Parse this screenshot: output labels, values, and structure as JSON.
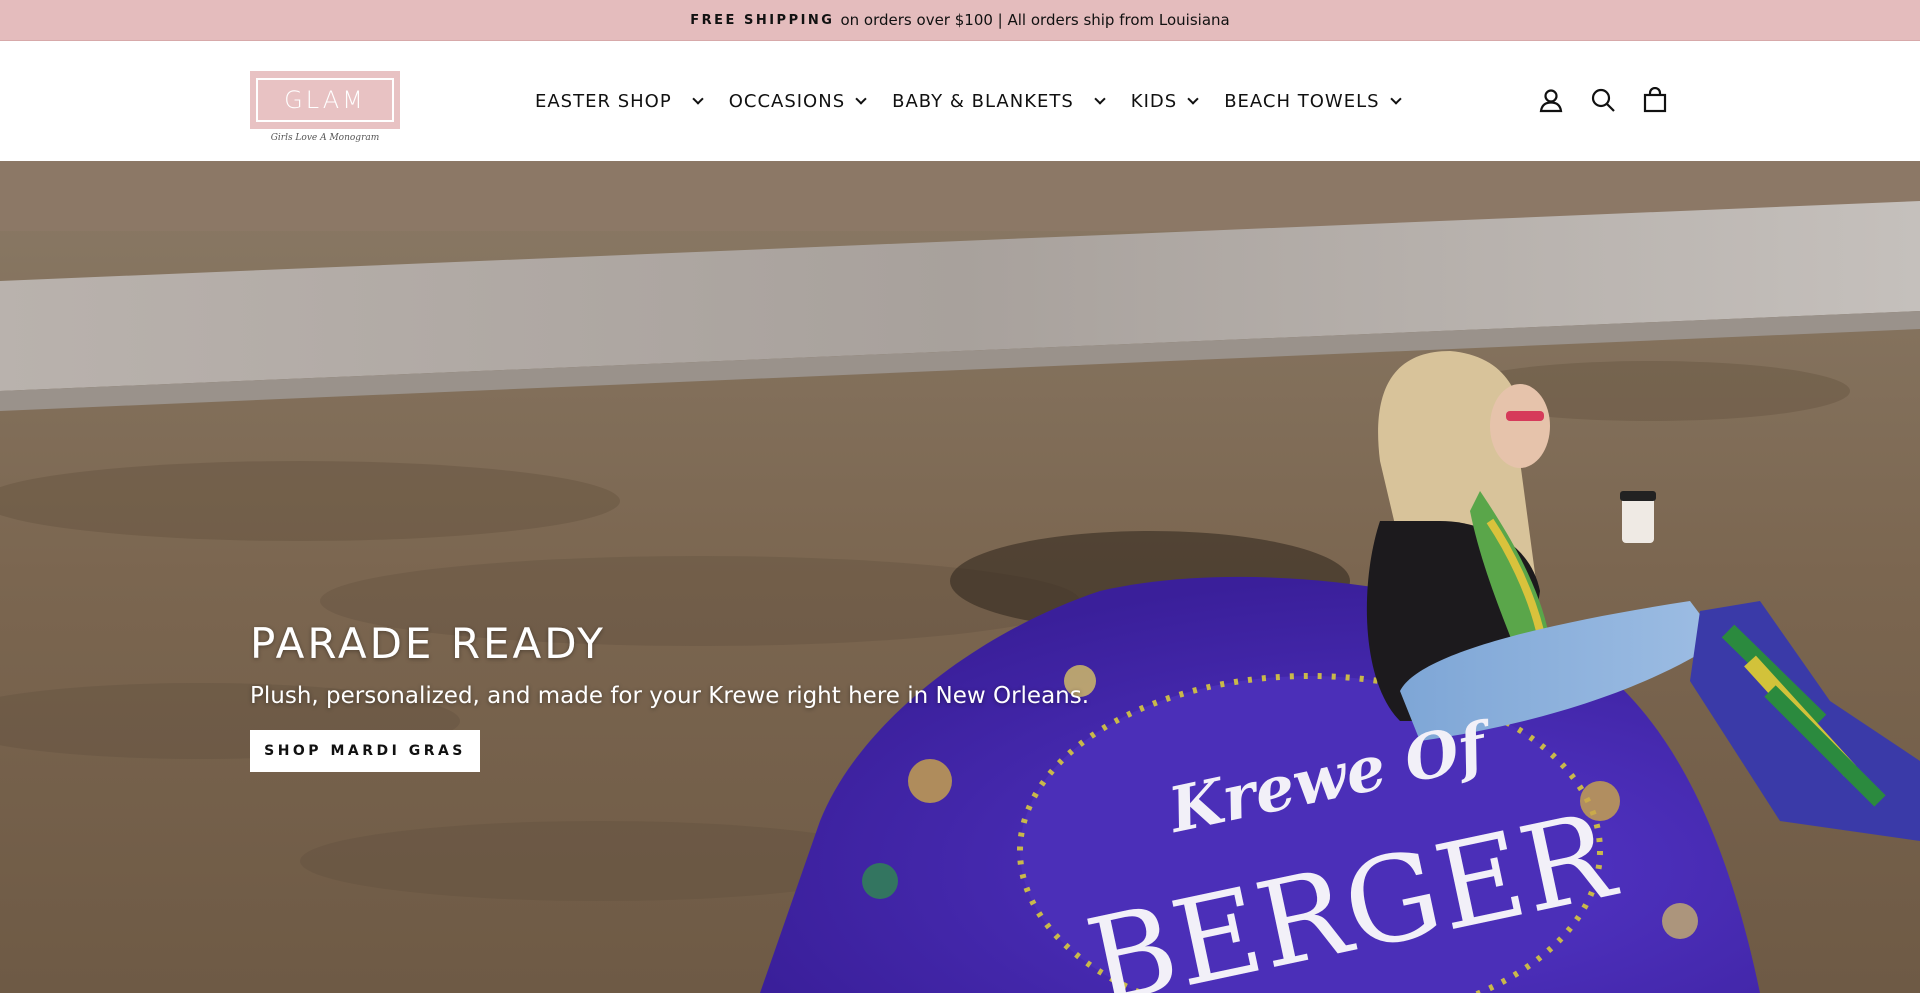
{
  "announcement": {
    "highlight": "FREE SHIPPING",
    "text": "on orders over $100 | All orders ship from Louisiana"
  },
  "logo": {
    "word": "GLAM",
    "tagline": "Girls Love A Monogram"
  },
  "nav": {
    "items": [
      {
        "label": "EASTER SHOP"
      },
      {
        "label": "OCCASIONS"
      },
      {
        "label": "BABY & BLANKETS"
      },
      {
        "label": "KIDS"
      },
      {
        "label": "BEACH TOWELS"
      }
    ]
  },
  "header_icons": [
    "account-icon",
    "search-icon",
    "cart-icon"
  ],
  "hero": {
    "title": "PARADE READY",
    "subtitle": "Plush, personalized, and made for your Krewe right here in New Orleans.",
    "button_label": "SHOP MARDI GRAS",
    "blanket_text_1": "Krewe Of",
    "blanket_text_2": "BERGER"
  },
  "colors": {
    "announcement_bg": "#e4bcbd",
    "logo_bg": "#e8c2c3",
    "blanket": "#4a2bb3"
  }
}
